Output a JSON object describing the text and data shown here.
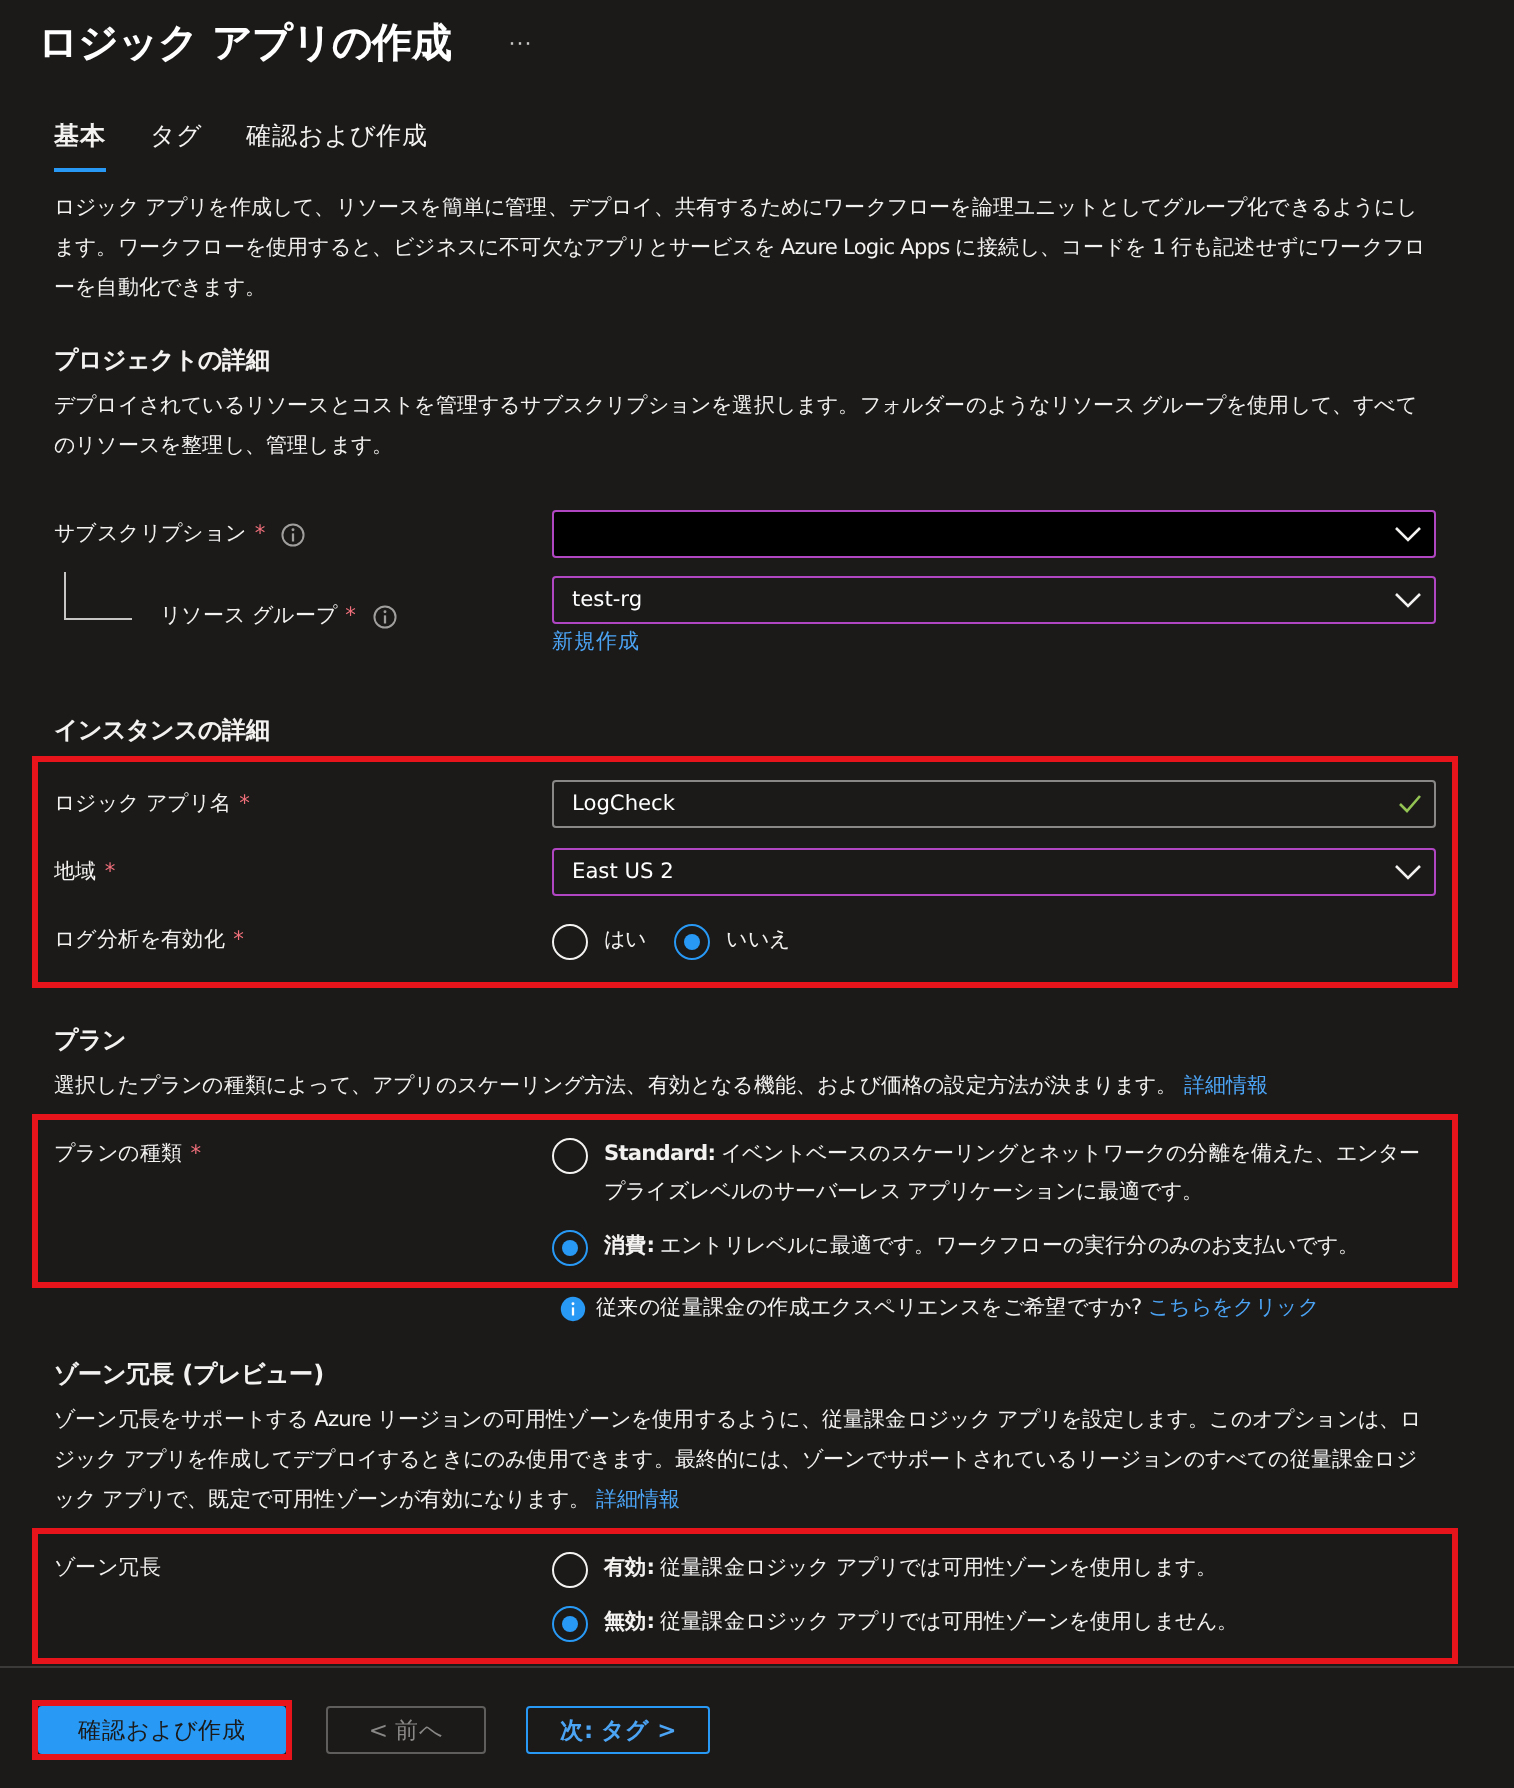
{
  "title": "ロジック アプリの作成",
  "more_button": "···",
  "tabs": [
    {
      "label": "基本",
      "selected": true
    },
    {
      "label": "タグ",
      "selected": false
    },
    {
      "label": "確認および作成",
      "selected": false
    }
  ],
  "intro": "ロジック アプリを作成して、リソースを簡単に管理、デプロイ、共有するためにワークフローを論理ユニットとしてグループ化できるようにします。ワークフローを使用すると、ビジネスに不可欠なアプリとサービスを Azure Logic Apps に接続し、コードを 1 行も記述せずにワークフローを自動化できます。",
  "sections": [
    {
      "heading": "プロジェクトの詳細",
      "description": "デプロイされているリソースとコストを管理するサブスクリプションを選択します。フォルダーのようなリソース グループを使用して、すべてのリソースを整理し、管理します。",
      "highlighted": false,
      "fields": [
        {
          "kind": "dropdown",
          "label": "サブスクリプション",
          "required_mark": "*",
          "info": true,
          "redacted": true,
          "children": [
            {
              "kind": "dropdown",
              "label": "リソース グループ",
              "required_mark": "*",
              "info": true,
              "value": "test-rg",
              "link": "新規作成"
            }
          ]
        }
      ]
    },
    {
      "heading": "インスタンスの詳細",
      "highlighted": true,
      "fields": [
        {
          "kind": "text",
          "label": "ロジック アプリ名",
          "required_mark": "*",
          "value": "LogCheck",
          "valid": true
        },
        {
          "kind": "dropdown",
          "label": "地域",
          "required_mark": "*",
          "value": "East US 2"
        },
        {
          "kind": "radio-row",
          "label": "ログ分析を有効化",
          "required_mark": "*",
          "options": [
            {
              "label": "はい",
              "selected": false
            },
            {
              "label": "いいえ",
              "selected": true
            }
          ]
        }
      ]
    },
    {
      "heading": "プラン",
      "description": "選択したプランの種類によって、アプリのスケーリング方法、有効となる機能、および価格の設定方法が決まります。",
      "link": "詳細情報",
      "highlighted": true,
      "fields": [
        {
          "kind": "radio-list",
          "label": "プランの種類",
          "required_mark": "*",
          "options": [
            {
              "label": "**Standard:** イベントベースのスケーリングとネットワークの分離を備えた、エンタープライズレベルのサーバーレス アプリケーションに最適です。",
              "selected": false
            },
            {
              "label": "**消費:** エントリレベルに最適です。ワークフローの実行分のみのお支払いです。",
              "selected": true
            }
          ]
        }
      ],
      "note": {
        "text": "従来の従量課金の作成エクスペリエンスをご希望ですか?",
        "link": "こちらをクリック"
      }
    },
    {
      "heading": "ゾーン冗長 (プレビュー)",
      "description": "ゾーン冗長をサポートする Azure リージョンの可用性ゾーンを使用するように、従量課金ロジック アプリを設定します。このオプションは、ロジック アプリを作成してデプロイするときにのみ使用できます。最終的には、ゾーンでサポートされているリージョンのすべての従量課金ロジック アプリで、既定で可用性ゾーンが有効になります。",
      "link": "詳細情報",
      "highlighted": true,
      "fields": [
        {
          "kind": "radio-list",
          "label": "ゾーン冗長",
          "options": [
            {
              "label": "**有効:** 従量課金ロジック アプリでは可用性ゾーンを使用します。",
              "selected": false
            },
            {
              "label": "**無効:** 従量課金ロジック アプリでは可用性ゾーンを使用しません。",
              "selected": true
            }
          ]
        }
      ]
    }
  ],
  "footer_buttons": [
    {
      "label": "確認および作成",
      "kind": "primary",
      "disabled": false,
      "highlighted": true
    },
    {
      "label": "< 前へ",
      "kind": "secondary",
      "disabled": true,
      "highlighted": false
    },
    {
      "label": "次: タグ >",
      "kind": "outline",
      "disabled": false,
      "highlighted": false
    }
  ]
}
